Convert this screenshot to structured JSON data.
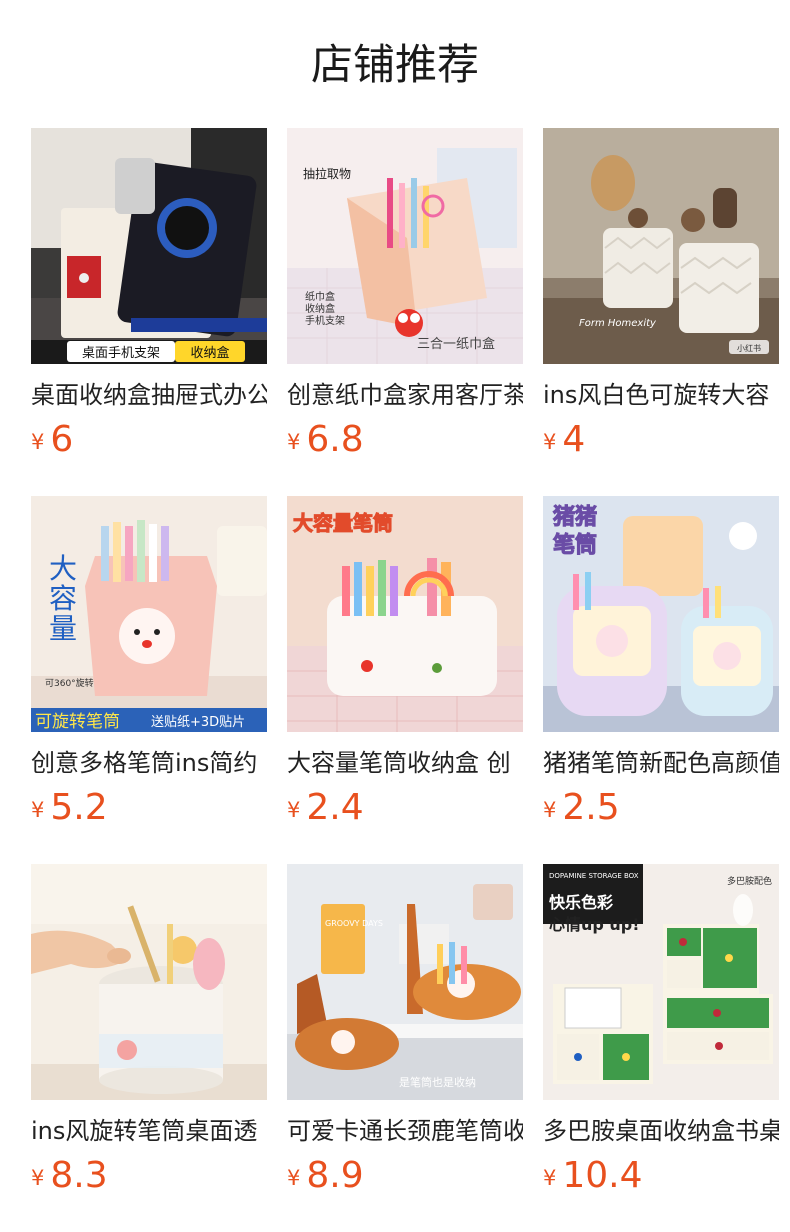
{
  "page": {
    "title": "店铺推荐"
  },
  "currency": "¥",
  "products": [
    {
      "name": "桌面收纳盒抽屉式办公",
      "price": "6",
      "overlay": [
        "桌面手机支架",
        "收纳盒"
      ]
    },
    {
      "name": "创意纸巾盒家用客厅茶",
      "price": "6.8",
      "overlay": [
        "抽拉取物",
        "纸巾盒",
        "收纳盒",
        "手机支架",
        "三合一纸巾盒"
      ]
    },
    {
      "name": "ins风白色可旋转大容",
      "price": "4",
      "overlay": [
        "Form Homexity",
        "小红书"
      ]
    },
    {
      "name": "创意多格笔筒ins简约",
      "price": "5.2",
      "overlay": [
        "大",
        "容",
        "量",
        "可360°旋转",
        "可旋转笔筒",
        "送贴纸+3D贴片"
      ]
    },
    {
      "name": "大容量笔筒收纳盒 创",
      "price": "2.4",
      "overlay": [
        "大容量笔筒"
      ]
    },
    {
      "name": "猪猪笔筒新配色高颜值",
      "price": "2.5",
      "overlay": [
        "猪猪",
        "笔筒"
      ]
    },
    {
      "name": "ins风旋转笔筒桌面透",
      "price": "8.3",
      "overlay": []
    },
    {
      "name": "可爱卡通长颈鹿笔筒收",
      "price": "8.9",
      "overlay": [
        "GROOVY DAYS",
        "是笔筒也是收纳"
      ]
    },
    {
      "name": "多巴胺桌面收纳盒书桌",
      "price": "10.4",
      "overlay": [
        "DOPAMINE STORAGE BOX",
        "多巴胺配色",
        "快乐色彩",
        "心情up up!"
      ]
    }
  ]
}
